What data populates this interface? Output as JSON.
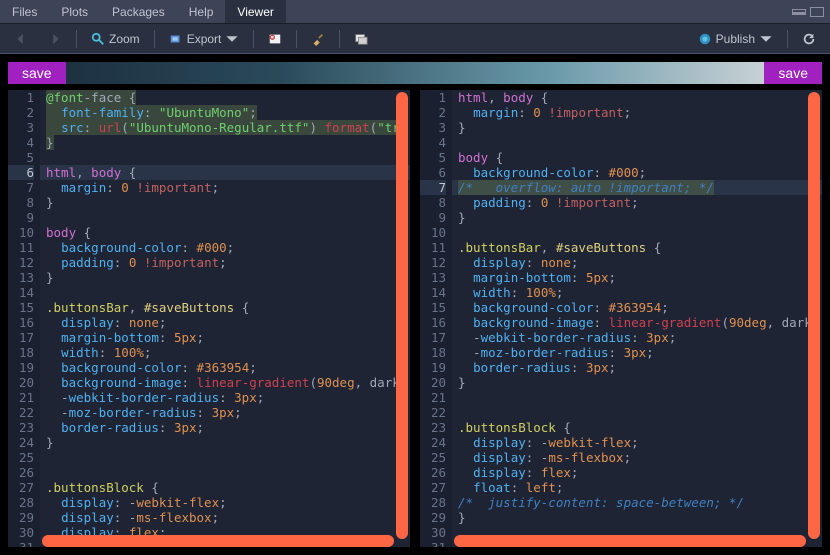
{
  "tabs": {
    "files": "Files",
    "plots": "Plots",
    "packages": "Packages",
    "help": "Help",
    "viewer": "Viewer"
  },
  "toolbar": {
    "zoom": "Zoom",
    "export": "Export",
    "publish": "Publish"
  },
  "save": "save",
  "left_lines": 31,
  "right_lines": 31,
  "left_hl": 6,
  "right_hl": 7,
  "left_code": [
    [
      [
        "at",
        "@font"
      ],
      [
        "pn",
        "-face {"
      ]
    ],
    [
      [
        "pn",
        "  "
      ],
      [
        "prop",
        "font-family"
      ],
      [
        "pn",
        ": "
      ],
      [
        "str",
        "\"UbuntuMono\""
      ],
      [
        "pn",
        ";"
      ]
    ],
    [
      [
        "pn",
        "  "
      ],
      [
        "prop",
        "src"
      ],
      [
        "pn",
        ": "
      ],
      [
        "fn",
        "url"
      ],
      [
        "pn",
        "("
      ],
      [
        "str",
        "\"UbuntuMono-Regular.ttf\""
      ],
      [
        "pn",
        ") "
      ],
      [
        "fn",
        "format"
      ],
      [
        "pn",
        "("
      ],
      [
        "str",
        "\"tr"
      ]
    ],
    [
      [
        "pn",
        "}"
      ]
    ],
    [],
    [
      [
        "tag",
        "html"
      ],
      [
        "pn",
        ", "
      ],
      [
        "tag",
        "body"
      ],
      [
        "pn",
        " {"
      ]
    ],
    [
      [
        "pn",
        "  "
      ],
      [
        "prop",
        "margin"
      ],
      [
        "pn",
        ": "
      ],
      [
        "num",
        "0"
      ],
      [
        "pn",
        " "
      ],
      [
        "imp",
        "!important"
      ],
      [
        "pn",
        ";"
      ]
    ],
    [
      [
        "pn",
        "}"
      ]
    ],
    [],
    [
      [
        "tag",
        "body"
      ],
      [
        "pn",
        " {"
      ]
    ],
    [
      [
        "pn",
        "  "
      ],
      [
        "prop",
        "background-color"
      ],
      [
        "pn",
        ": "
      ],
      [
        "num",
        "#000"
      ],
      [
        "pn",
        ";"
      ]
    ],
    [
      [
        "pn",
        "  "
      ],
      [
        "prop",
        "padding"
      ],
      [
        "pn",
        ": "
      ],
      [
        "num",
        "0"
      ],
      [
        "pn",
        " "
      ],
      [
        "imp",
        "!important"
      ],
      [
        "pn",
        ";"
      ]
    ],
    [
      [
        "pn",
        "}"
      ]
    ],
    [],
    [
      [
        "sel",
        ".buttonsBar"
      ],
      [
        "pn",
        ", "
      ],
      [
        "id",
        "#saveButtons"
      ],
      [
        "pn",
        " {"
      ]
    ],
    [
      [
        "pn",
        "  "
      ],
      [
        "prop",
        "display"
      ],
      [
        "pn",
        ": "
      ],
      [
        "num",
        "none"
      ],
      [
        "pn",
        ";"
      ]
    ],
    [
      [
        "pn",
        "  "
      ],
      [
        "prop",
        "margin-bottom"
      ],
      [
        "pn",
        ": "
      ],
      [
        "num",
        "5px"
      ],
      [
        "pn",
        ";"
      ]
    ],
    [
      [
        "pn",
        "  "
      ],
      [
        "prop",
        "width"
      ],
      [
        "pn",
        ": "
      ],
      [
        "num",
        "100%"
      ],
      [
        "pn",
        ";"
      ]
    ],
    [
      [
        "pn",
        "  "
      ],
      [
        "prop",
        "background-color"
      ],
      [
        "pn",
        ": "
      ],
      [
        "num",
        "#363954"
      ],
      [
        "pn",
        ";"
      ]
    ],
    [
      [
        "pn",
        "  "
      ],
      [
        "prop",
        "background-image"
      ],
      [
        "pn",
        ": "
      ],
      [
        "fn",
        "linear-gradient"
      ],
      [
        "pn",
        "("
      ],
      [
        "num",
        "90deg"
      ],
      [
        "pn",
        ", dark"
      ]
    ],
    [
      [
        "pn",
        "  -"
      ],
      [
        "prop",
        "webkit-border-radius"
      ],
      [
        "pn",
        ": "
      ],
      [
        "num",
        "3px"
      ],
      [
        "pn",
        ";"
      ]
    ],
    [
      [
        "pn",
        "  -"
      ],
      [
        "prop",
        "moz-border-radius"
      ],
      [
        "pn",
        ": "
      ],
      [
        "num",
        "3px"
      ],
      [
        "pn",
        ";"
      ]
    ],
    [
      [
        "pn",
        "  "
      ],
      [
        "prop",
        "border-radius"
      ],
      [
        "pn",
        ": "
      ],
      [
        "num",
        "3px"
      ],
      [
        "pn",
        ";"
      ]
    ],
    [
      [
        "pn",
        "}"
      ]
    ],
    [],
    [],
    [
      [
        "sel",
        ".buttonsBlock"
      ],
      [
        "pn",
        " {"
      ]
    ],
    [
      [
        "pn",
        "  "
      ],
      [
        "prop",
        "display"
      ],
      [
        "pn",
        ": -"
      ],
      [
        "num",
        "webkit-flex"
      ],
      [
        "pn",
        ";"
      ]
    ],
    [
      [
        "pn",
        "  "
      ],
      [
        "prop",
        "display"
      ],
      [
        "pn",
        ": -"
      ],
      [
        "num",
        "ms-flexbox"
      ],
      [
        "pn",
        ";"
      ]
    ],
    [
      [
        "pn",
        "  "
      ],
      [
        "prop",
        "display"
      ],
      [
        "pn",
        ": "
      ],
      [
        "num",
        "flex"
      ],
      [
        "pn",
        ";"
      ]
    ],
    []
  ],
  "right_code": [
    [
      [
        "tag",
        "html"
      ],
      [
        "pn",
        ", "
      ],
      [
        "tag",
        "body"
      ],
      [
        "pn",
        " {"
      ]
    ],
    [
      [
        "pn",
        "  "
      ],
      [
        "prop",
        "margin"
      ],
      [
        "pn",
        ": "
      ],
      [
        "num",
        "0"
      ],
      [
        "pn",
        " "
      ],
      [
        "imp",
        "!important"
      ],
      [
        "pn",
        ";"
      ]
    ],
    [
      [
        "pn",
        "}"
      ]
    ],
    [],
    [
      [
        "tag",
        "body"
      ],
      [
        "pn",
        " {"
      ]
    ],
    [
      [
        "pn",
        "  "
      ],
      [
        "prop",
        "background-color"
      ],
      [
        "pn",
        ": "
      ],
      [
        "num",
        "#000"
      ],
      [
        "pn",
        ";"
      ]
    ],
    [
      [
        "cm",
        "/*   overflow: auto !important; */"
      ]
    ],
    [
      [
        "pn",
        "  "
      ],
      [
        "prop",
        "padding"
      ],
      [
        "pn",
        ": "
      ],
      [
        "num",
        "0"
      ],
      [
        "pn",
        " "
      ],
      [
        "imp",
        "!important"
      ],
      [
        "pn",
        ";"
      ]
    ],
    [
      [
        "pn",
        "}"
      ]
    ],
    [],
    [
      [
        "sel",
        ".buttonsBar"
      ],
      [
        "pn",
        ", "
      ],
      [
        "id",
        "#saveButtons"
      ],
      [
        "pn",
        " {"
      ]
    ],
    [
      [
        "pn",
        "  "
      ],
      [
        "prop",
        "display"
      ],
      [
        "pn",
        ": "
      ],
      [
        "num",
        "none"
      ],
      [
        "pn",
        ";"
      ]
    ],
    [
      [
        "pn",
        "  "
      ],
      [
        "prop",
        "margin-bottom"
      ],
      [
        "pn",
        ": "
      ],
      [
        "num",
        "5px"
      ],
      [
        "pn",
        ";"
      ]
    ],
    [
      [
        "pn",
        "  "
      ],
      [
        "prop",
        "width"
      ],
      [
        "pn",
        ": "
      ],
      [
        "num",
        "100%"
      ],
      [
        "pn",
        ";"
      ]
    ],
    [
      [
        "pn",
        "  "
      ],
      [
        "prop",
        "background-color"
      ],
      [
        "pn",
        ": "
      ],
      [
        "num",
        "#363954"
      ],
      [
        "pn",
        ";"
      ]
    ],
    [
      [
        "pn",
        "  "
      ],
      [
        "prop",
        "background-image"
      ],
      [
        "pn",
        ": "
      ],
      [
        "fn",
        "linear-gradient"
      ],
      [
        "pn",
        "("
      ],
      [
        "num",
        "90deg"
      ],
      [
        "pn",
        ", dark"
      ]
    ],
    [
      [
        "pn",
        "  -"
      ],
      [
        "prop",
        "webkit-border-radius"
      ],
      [
        "pn",
        ": "
      ],
      [
        "num",
        "3px"
      ],
      [
        "pn",
        ";"
      ]
    ],
    [
      [
        "pn",
        "  -"
      ],
      [
        "prop",
        "moz-border-radius"
      ],
      [
        "pn",
        ": "
      ],
      [
        "num",
        "3px"
      ],
      [
        "pn",
        ";"
      ]
    ],
    [
      [
        "pn",
        "  "
      ],
      [
        "prop",
        "border-radius"
      ],
      [
        "pn",
        ": "
      ],
      [
        "num",
        "3px"
      ],
      [
        "pn",
        ";"
      ]
    ],
    [
      [
        "pn",
        "}"
      ]
    ],
    [],
    [],
    [
      [
        "sel",
        ".buttonsBlock"
      ],
      [
        "pn",
        " {"
      ]
    ],
    [
      [
        "pn",
        "  "
      ],
      [
        "prop",
        "display"
      ],
      [
        "pn",
        ": -"
      ],
      [
        "num",
        "webkit-flex"
      ],
      [
        "pn",
        ";"
      ]
    ],
    [
      [
        "pn",
        "  "
      ],
      [
        "prop",
        "display"
      ],
      [
        "pn",
        ": -"
      ],
      [
        "num",
        "ms-flexbox"
      ],
      [
        "pn",
        ";"
      ]
    ],
    [
      [
        "pn",
        "  "
      ],
      [
        "prop",
        "display"
      ],
      [
        "pn",
        ": "
      ],
      [
        "num",
        "flex"
      ],
      [
        "pn",
        ";"
      ]
    ],
    [
      [
        "pn",
        "  "
      ],
      [
        "prop",
        "float"
      ],
      [
        "pn",
        ": "
      ],
      [
        "num",
        "left"
      ],
      [
        "pn",
        ";"
      ]
    ],
    [
      [
        "cm",
        "/*  justify-content: space-between; */"
      ]
    ],
    [
      [
        "pn",
        "}"
      ]
    ],
    [],
    []
  ]
}
